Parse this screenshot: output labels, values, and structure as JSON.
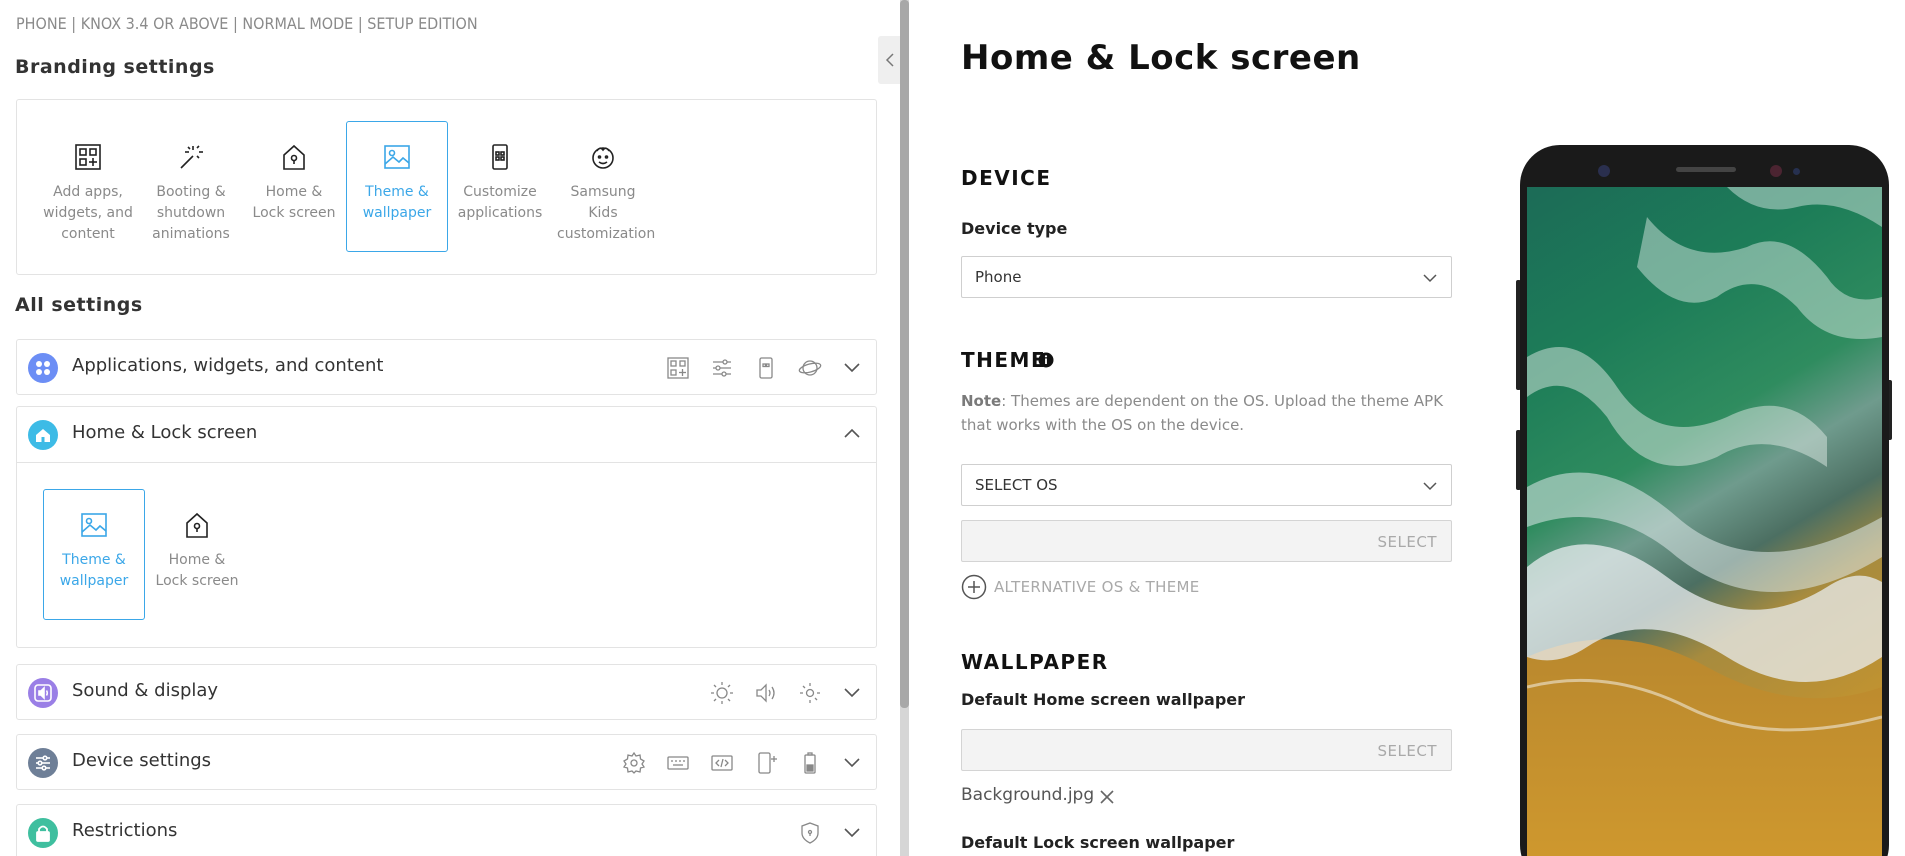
{
  "header": {
    "edition": "PHONE | KNOX 3.4 OR ABOVE | NORMAL MODE | SETUP EDITION"
  },
  "branding": {
    "title": "Branding settings",
    "tiles": [
      {
        "label": "Add apps, widgets, and content",
        "icon": "apps-grid-icon"
      },
      {
        "label": "Booting & shutdown animations",
        "icon": "magic-wand-icon"
      },
      {
        "label": "Home & Lock screen",
        "icon": "home-lock-icon"
      },
      {
        "label": "Theme & wallpaper",
        "icon": "image-icon",
        "selected": true
      },
      {
        "label": "Customize applications",
        "icon": "phone-apps-icon"
      },
      {
        "label": "Samsung Kids customization",
        "icon": "kids-face-icon"
      }
    ]
  },
  "all_settings": {
    "title": "All settings",
    "rows": [
      {
        "label": "Applications, widgets, and content",
        "color": "#6c8ef5"
      },
      {
        "label": "Home & Lock screen",
        "color": "#3dbbe6",
        "expanded": true,
        "tiles": [
          {
            "label": "Theme & wallpaper",
            "selected": true
          },
          {
            "label": "Home & Lock screen"
          }
        ]
      },
      {
        "label": "Sound & display",
        "color": "#9a7fe6"
      },
      {
        "label": "Device settings",
        "color": "#6e7f97"
      },
      {
        "label": "Restrictions",
        "color": "#3fbf9f"
      }
    ]
  },
  "main": {
    "title": "Home & Lock screen",
    "device": {
      "section": "DEVICE",
      "label": "Device type",
      "value": "Phone"
    },
    "theme": {
      "section": "THEME",
      "note_label": "Note",
      "note_text": ": Themes are dependent on the OS. Upload the theme APK that works with the OS on the device.",
      "os_value": "SELECT OS",
      "select_label": "SELECT",
      "alt_label": "ALTERNATIVE OS & THEME"
    },
    "wallpaper": {
      "section": "WALLPAPER",
      "home_label": "Default Home screen wallpaper",
      "select_label": "SELECT",
      "file_name": "Background.jpg",
      "lock_label": "Default Lock screen wallpaper"
    }
  },
  "colors": {
    "accent": "#3ba7e8"
  }
}
